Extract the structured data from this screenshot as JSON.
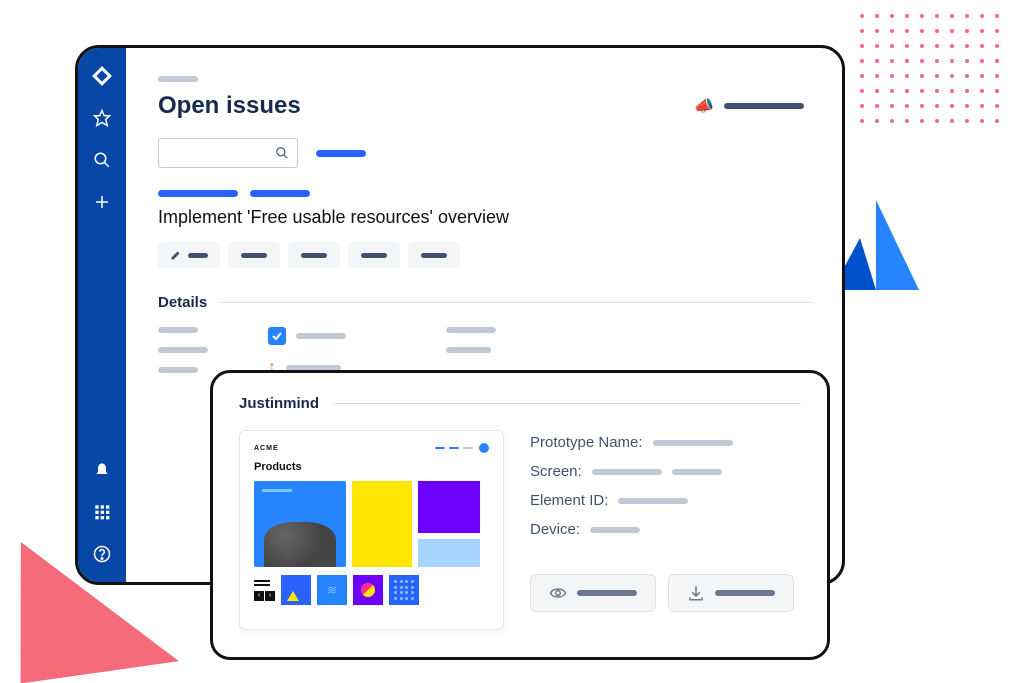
{
  "page_title": "Open issues",
  "issue_title": "Implement 'Free usable resources' overview",
  "details_section_label": "Details",
  "justinmind": {
    "section_label": "Justinmind",
    "preview_logo": "ACME",
    "preview_title": "Products",
    "meta": {
      "prototype_name_label": "Prototype Name:",
      "screen_label": "Screen:",
      "element_id_label": "Element ID:",
      "device_label": "Device:"
    }
  }
}
